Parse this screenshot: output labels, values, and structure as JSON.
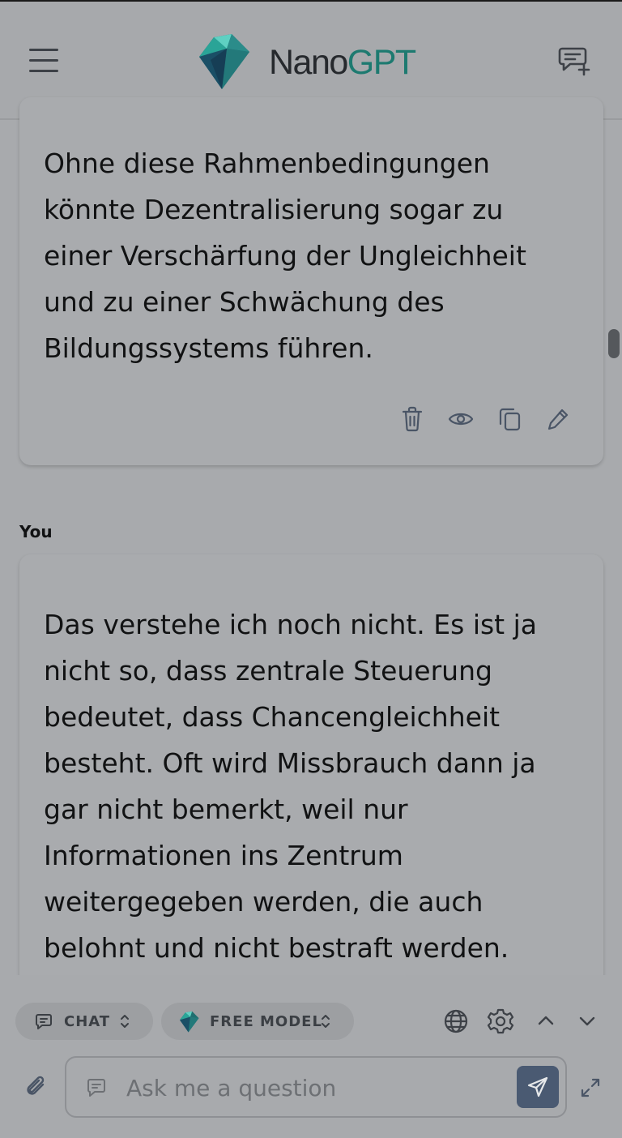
{
  "header": {
    "brand_nano": "Nano",
    "brand_gpt": "GPT",
    "menu_icon": "hamburger-icon",
    "new_chat_icon": "new-chat-icon"
  },
  "assistant_message": {
    "text": "Ohne diese Rahmenbedingungen\nkönnte Dezentralisierung sogar zu\neiner Verschärfung der Ungleichheit\nund zu einer Schwächung des\nBildungssystems führen.",
    "actions": [
      "trash-icon",
      "eye-icon",
      "copy-icon",
      "edit-icon"
    ]
  },
  "user_message": {
    "author": "You",
    "text": "Das verstehe ich noch nicht. Es ist ja\nnicht so, dass zentrale Steuerung\nbedeutet, dass Chancengleichheit\nbesteht. Oft wird Missbrauch dann ja\ngar nicht bemerkt, weil nur\nInformationen ins Zentrum\nweitergegeben werden, die auch\nbelohnt und nicht bestraft werden."
  },
  "toolbar": {
    "mode_label": "CHAT",
    "model_label": "FREE MODEL"
  },
  "composer": {
    "placeholder": "Ask me a question"
  },
  "colors": {
    "accent": "#1d7a70",
    "send_button": "#4a5a72",
    "background": "#a8aaad"
  }
}
